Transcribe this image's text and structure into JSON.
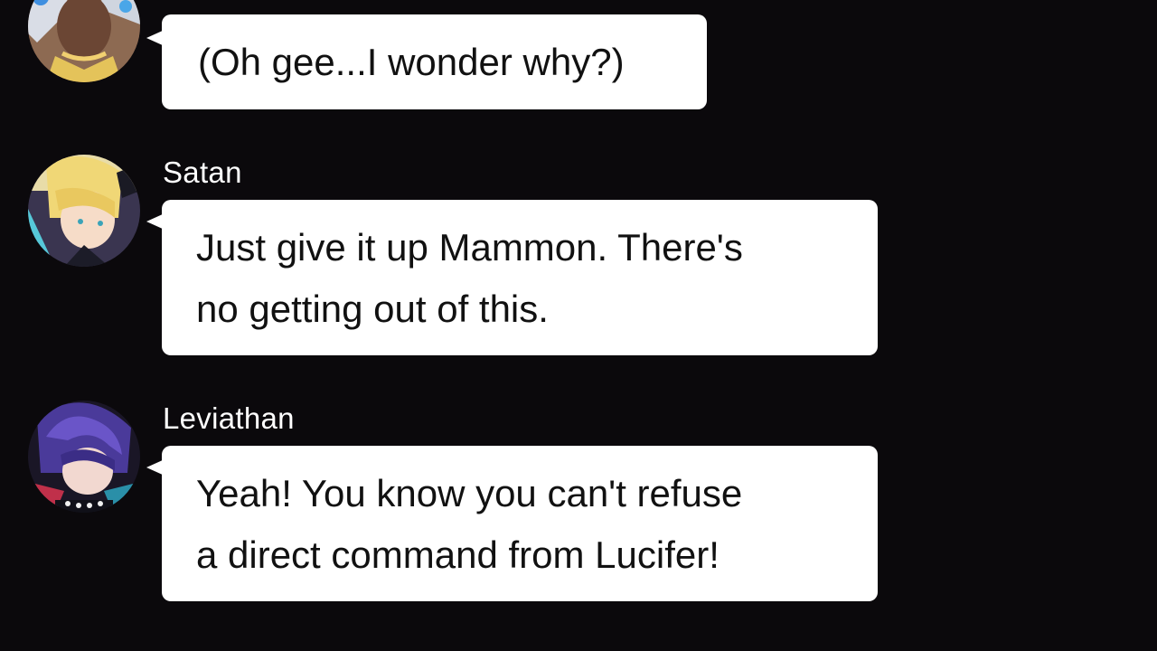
{
  "messages": [
    {
      "sender": "",
      "lines": [
        "(Oh gee...I wonder why?)"
      ],
      "avatar_icon": "mc-avatar"
    },
    {
      "sender": "Satan",
      "lines": [
        "Just give it up Mammon. There's",
        "no getting out of this."
      ],
      "avatar_icon": "satan-avatar"
    },
    {
      "sender": "Leviathan",
      "lines": [
        "Yeah! You know you can't refuse",
        "a direct command from Lucifer!"
      ],
      "avatar_icon": "leviathan-avatar"
    }
  ],
  "colors": {
    "background": "#0b090c",
    "bubble": "#ffffff",
    "bubble_text": "#111111",
    "name_text": "#ffffff"
  }
}
